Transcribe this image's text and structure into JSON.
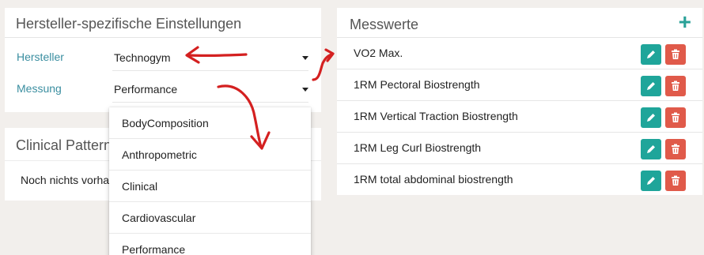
{
  "settings": {
    "title": "Hersteller-spezifische Einstellungen",
    "manufacturer_label": "Hersteller",
    "manufacturer_value": "Technogym",
    "measurement_label": "Messung",
    "measurement_value": "Performance"
  },
  "clinical": {
    "title": "Clinical Patterns",
    "empty_text": "Noch nichts vorhanden"
  },
  "dropdown": {
    "options": [
      "BodyComposition",
      "Anthropometric",
      "Clinical",
      "Cardiovascular",
      "Performance"
    ]
  },
  "measurements": {
    "title": "Messwerte",
    "add_label": "+",
    "items": [
      "VO2 Max.",
      "1RM Pectoral Biostrength",
      "1RM Vertical Traction Biostrength",
      "1RM Leg Curl Biostrength",
      "1RM total abdominal biostrength"
    ]
  },
  "colors": {
    "accent": "#2aa198",
    "edit": "#1fa59a",
    "delete": "#e05a4a",
    "label": "#3a8ea0",
    "annotation": "#d42020"
  },
  "icons": {
    "edit": "pencil-icon",
    "delete": "trash-icon",
    "add": "plus-icon"
  }
}
